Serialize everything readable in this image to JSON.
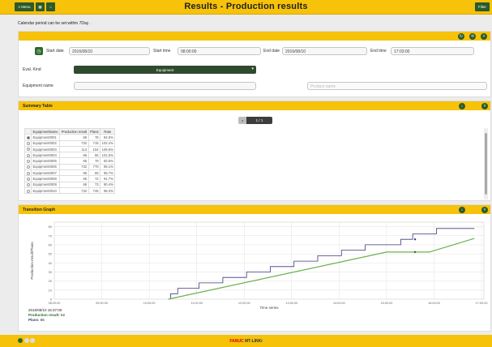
{
  "toolbar": {
    "menu_label": "≡ Menu",
    "filter_label": "Filter"
  },
  "page": {
    "title": "Results - Production results",
    "note": "Calendar period can be set within 7Day ."
  },
  "condition": {
    "start_date_label": "Start date",
    "start_date": "2016/08/10",
    "start_time_label": "Start time",
    "start_time": "08:00:00",
    "end_date_label": "End date",
    "end_date": "2016/08/10",
    "end_time_label": "End time",
    "end_time": "17:03:00",
    "eval_kind_label": "Eval. Kind",
    "eval_kind_value": "Equipment",
    "equipment_name_label": "Equipment name",
    "equipment_name": "",
    "product_name_label": "",
    "product_name_placeholder": "Product name"
  },
  "summary": {
    "title": "Summary Table",
    "pager_text": "1 / 1",
    "columns": [
      "",
      "EquipmentName",
      "Production result",
      "Plans",
      "Rate"
    ],
    "rows": [
      [
        "Equipment0001",
        "66",
        "78",
        "84.6%"
      ],
      [
        "Equipment0002",
        "732",
        "715",
        "102.4%"
      ],
      [
        "Equipment0003",
        "114",
        "104",
        "109.6%"
      ],
      [
        "Equipment0004",
        "66",
        "65",
        "101.5%"
      ],
      [
        "Equipment0005",
        "66",
        "79",
        "83.5%"
      ],
      [
        "Equipment0006",
        "732",
        "770",
        "95.1%"
      ],
      [
        "Equipment0007",
        "66",
        "69",
        "95.7%"
      ],
      [
        "Equipment0008",
        "66",
        "72",
        "91.7%"
      ],
      [
        "Equipment0009",
        "66",
        "73",
        "90.4%"
      ],
      [
        "Equipment0010",
        "732",
        "745",
        "98.3%"
      ]
    ],
    "selected_index": 0
  },
  "graph": {
    "title": "Transition Graph",
    "info_time": "2016/08/10 15:37:00",
    "info_result_label": "Production result:",
    "info_result_value": "52",
    "info_plans_label": "Plans:",
    "info_plans_value": "66"
  },
  "chart_data": {
    "type": "line",
    "xlabel": "Time series",
    "ylabel": "Production result/Plans",
    "ylim": [
      0,
      85
    ],
    "yticks": [
      0,
      10,
      20,
      30,
      40,
      50,
      60,
      70,
      80
    ],
    "xlim": [
      8,
      17.05
    ],
    "xticks": [
      "08:00:00",
      "09:00:00",
      "10:00:00",
      "11:00:00",
      "12:00:00",
      "13:00:00",
      "14:00:00",
      "15:00:00",
      "16:00:00",
      "17:00:00"
    ],
    "grid": true,
    "series": [
      {
        "name": "",
        "color": "#3a3a7a",
        "step": true,
        "x": [
          10.45,
          10.45,
          10.6,
          10.6,
          11.05,
          11.05,
          11.55,
          11.55,
          12.05,
          12.05,
          12.55,
          12.55,
          13.05,
          13.05,
          13.55,
          13.55,
          14.05,
          14.05,
          14.55,
          14.55,
          15.0,
          15.0,
          15.3,
          15.3,
          15.55,
          15.55,
          16.05,
          16.05,
          16.5,
          16.5,
          16.85
        ],
        "y": [
          0,
          6,
          6,
          12,
          12,
          18,
          18,
          24,
          24,
          30,
          30,
          36,
          36,
          42,
          42,
          48,
          48,
          54,
          54,
          60,
          60,
          60,
          60,
          66,
          66,
          72,
          72,
          78,
          78,
          78,
          78
        ]
      },
      {
        "name": "",
        "color": "#6ab04c",
        "step": false,
        "x": [
          10.4,
          15.0,
          15.9,
          16.85
        ],
        "y": [
          0,
          52,
          52,
          67
        ]
      }
    ],
    "markers": [
      {
        "x": 15.6,
        "y": 66,
        "color": "#3a3a7a"
      },
      {
        "x": 15.6,
        "y": 52,
        "color": "#2c6a2c"
      }
    ]
  },
  "footer": {
    "brand_a": "FANUC",
    "brand_b": "MT-LINKi"
  },
  "colors": {
    "accent": "#f6c20a",
    "button": "#2c5a2c"
  }
}
